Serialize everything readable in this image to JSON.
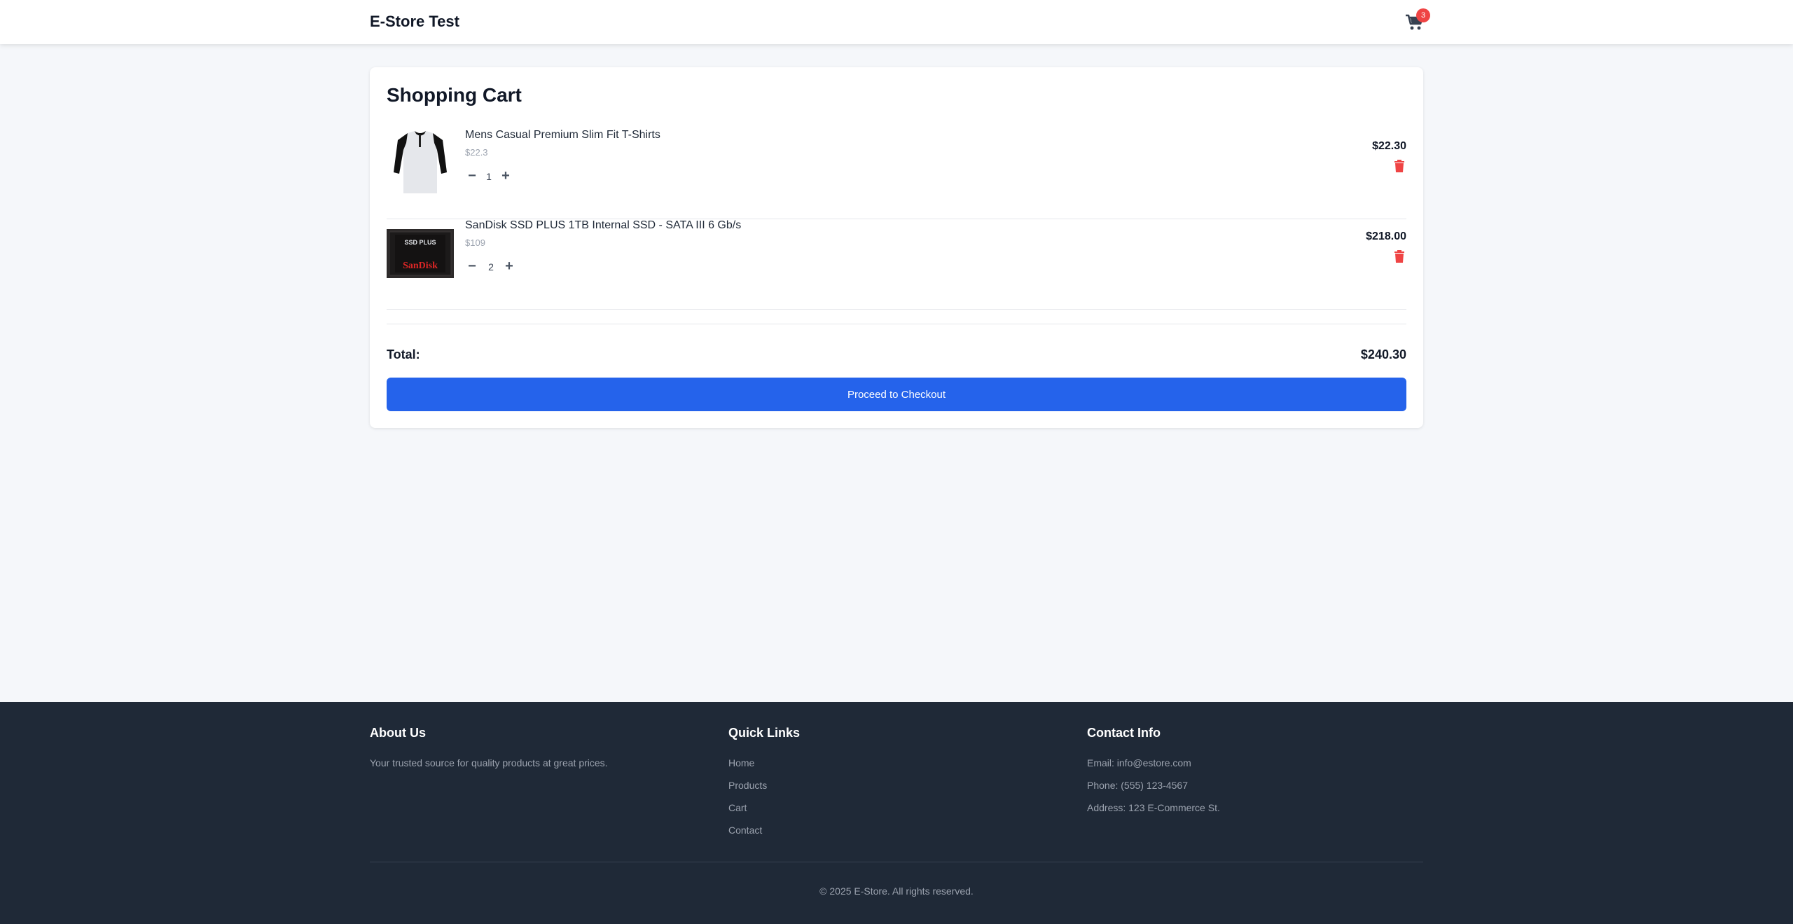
{
  "header": {
    "brand": "E-Store Test",
    "cart_count": "3"
  },
  "cart": {
    "title": "Shopping Cart",
    "items": [
      {
        "name": "Mens Casual Premium Slim Fit T-Shirts",
        "unit_price": "$22.3",
        "quantity": "1",
        "line_total": "$22.30",
        "image": "tshirt-image"
      },
      {
        "name": "SanDisk SSD PLUS 1TB Internal SSD - SATA III 6 Gb/s",
        "unit_price": "$109",
        "quantity": "2",
        "line_total": "$218.00",
        "image": "ssd-image",
        "image_text": [
          "SSD PLUS",
          "SanDisk"
        ]
      }
    ],
    "total_label": "Total:",
    "total_value": "$240.30",
    "checkout_label": "Proceed to Checkout"
  },
  "footer": {
    "about": {
      "heading": "About Us",
      "text": "Your trusted source for quality products at great prices."
    },
    "links": {
      "heading": "Quick Links",
      "items": [
        "Home",
        "Products",
        "Cart",
        "Contact"
      ]
    },
    "contact": {
      "heading": "Contact Info",
      "email": "Email: info@estore.com",
      "phone": "Phone: (555) 123-4567",
      "address": "Address: 123 E-Commerce St."
    },
    "copyright": "© 2025 E-Store. All rights reserved."
  },
  "colors": {
    "accent": "#2563eb",
    "danger": "#ef4444",
    "footer_bg": "#1f2937",
    "page_bg": "#f5f7fa"
  }
}
